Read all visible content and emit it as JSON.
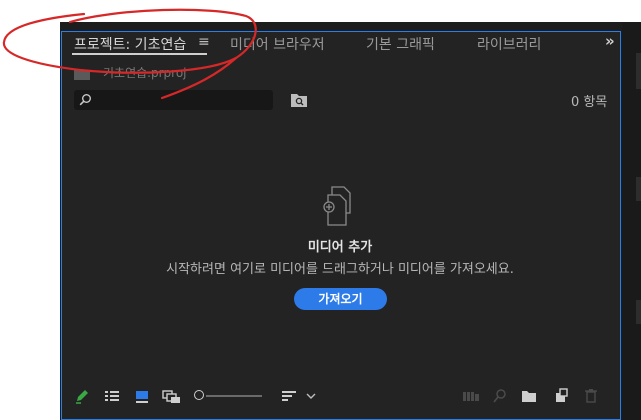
{
  "tabs": [
    {
      "label": "프로젝트: 기초연습",
      "active": true
    },
    {
      "label": "미디어 브라우저",
      "active": false
    },
    {
      "label": "기본 그래픽",
      "active": false
    },
    {
      "label": "라이브러리",
      "active": false
    }
  ],
  "tab_menu_glyph": "≡",
  "overflow_glyph": "»",
  "project": {
    "file_name": "기초연습.prproj"
  },
  "search": {
    "placeholder": "",
    "item_count": "0 항목"
  },
  "empty_state": {
    "title": "미디어 추가",
    "description": "시작하려면 여기로 미디어를 드래그하거나 미디어를 가져오세요.",
    "import_button": "가져오기"
  },
  "toolbar_icons": [
    "pencil-icon",
    "list-view-icon",
    "icon-view-icon",
    "freeform-view-icon",
    "zoom-slider",
    "sort-icon",
    "chevron-down-icon",
    "automate-sequence-icon",
    "find-icon",
    "new-bin-icon",
    "new-item-icon",
    "trash-icon"
  ],
  "colors": {
    "accent": "#2c7be8",
    "panel_bg": "#232323",
    "annotation": "#d62828",
    "pencil": "#3aa845"
  }
}
